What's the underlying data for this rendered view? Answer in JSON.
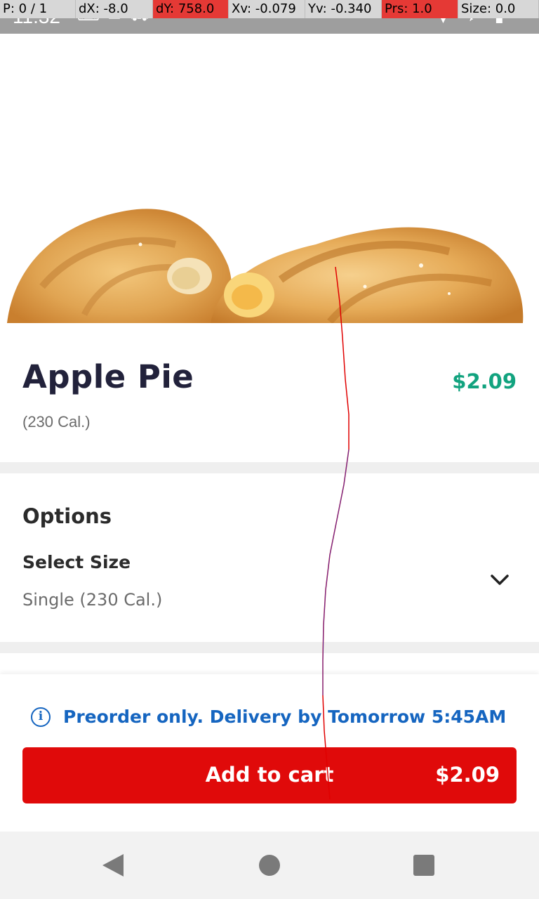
{
  "status_bar": {
    "time": "11:32",
    "left_icons": [
      "gboard-icon",
      "gmail-icon",
      "delivery-truck-icon"
    ],
    "right_icons": [
      "wifi-icon",
      "airplane-mode-icon",
      "battery-icon"
    ]
  },
  "pointer_location": {
    "p": "P: 0 / 1",
    "dx": "dX: -8.0",
    "dy": "dY: 758.0",
    "xv": "Xv: -0.079",
    "yv": "Yv: -0.340",
    "prs": "Prs: 1.0",
    "size": "Size: 0.0"
  },
  "product": {
    "name": "Apple Pie",
    "price": "$2.09",
    "calories": "(230 Cal.)"
  },
  "options": {
    "title": "Options",
    "select_size_label": "Select Size",
    "select_size_value": "Single (230 Cal.)"
  },
  "notice": {
    "text": "Preorder only. Delivery by Tomorrow 5:45AM"
  },
  "cart_button": {
    "label": "Add to cart",
    "price": "$2.09"
  },
  "colors": {
    "brand_red": "#e00a0a",
    "price_green": "#12a37f",
    "notice_blue": "#1565c0",
    "title_dark": "#22223b"
  }
}
